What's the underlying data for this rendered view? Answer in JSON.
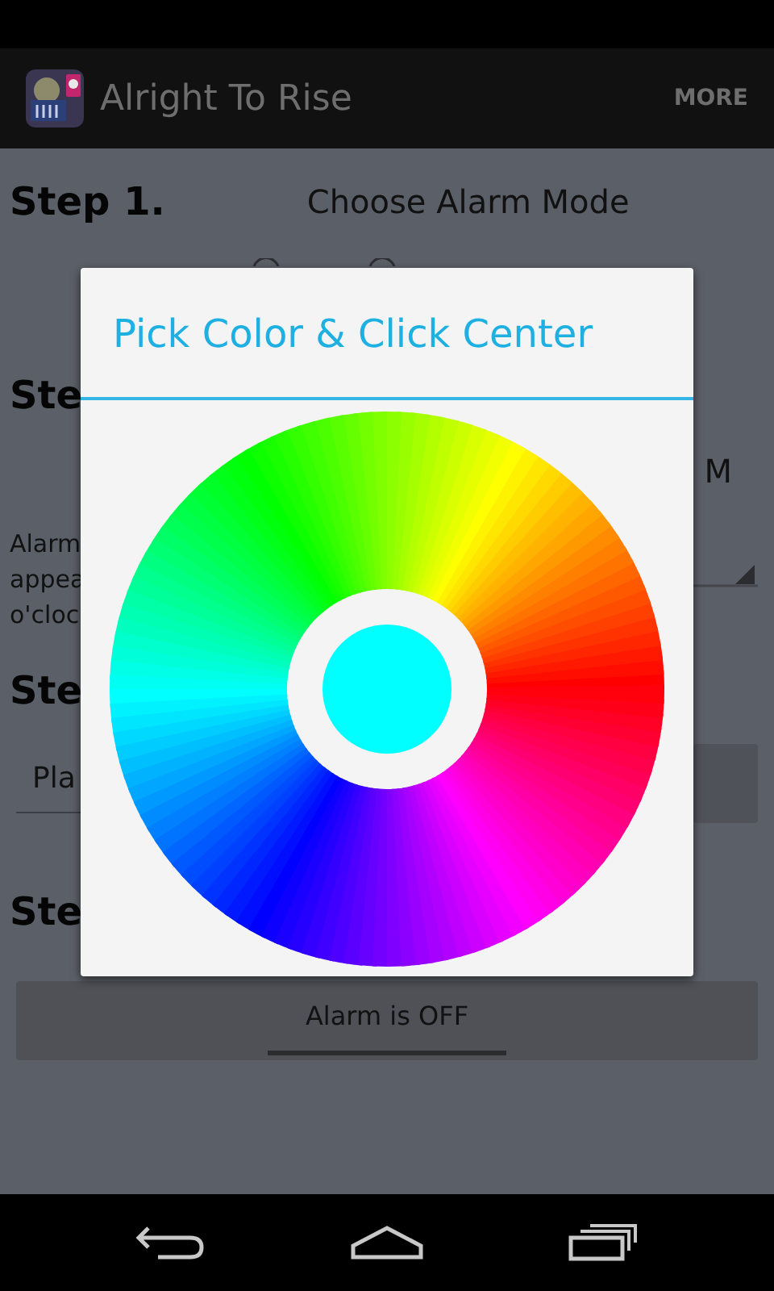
{
  "action_bar": {
    "title": "Alright To Rise",
    "menu": "MORE"
  },
  "background": {
    "step_1": {
      "label": "Step 1.",
      "text": "Choose Alarm Mode"
    },
    "step_2": {
      "label": "Ste",
      "text": "M",
      "description": [
        "Alarm",
        "appea",
        "o'cloc"
      ]
    },
    "step_3": {
      "label": "Ste",
      "field": "Pla"
    },
    "step_4": {
      "label": "Ste",
      "button": "Alarm is OFF",
      "button_on": false
    }
  },
  "dialog": {
    "title": "Pick Color & Click Center"
  }
}
